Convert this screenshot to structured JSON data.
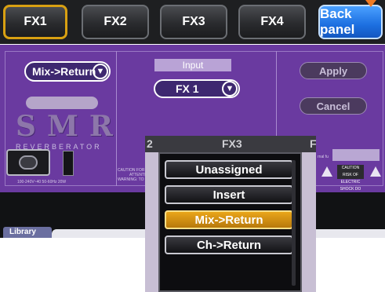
{
  "tabs": [
    {
      "label": "FX1",
      "active": true
    },
    {
      "label": "FX2",
      "active": false
    },
    {
      "label": "FX3",
      "active": false
    },
    {
      "label": "FX4",
      "active": false
    }
  ],
  "back_panel_label": "Back panel",
  "panel": {
    "routing_value": "Mix->Return",
    "input_label": "Input",
    "fx_value": "FX 1",
    "apply_label": "Apply",
    "cancel_label": "Cancel",
    "brand": "SMR",
    "subbrand": "REVERBERATOR",
    "power_spec": "100-240V~40 50-60Hz 20W",
    "caution_line1": "CAUTION FOR CONTINUED PROTECTION",
    "caution_line2": "ATTENTION",
    "caution_line3": "WARNING: TO REDUCE THE RISK",
    "caution_badge": "CAUTION",
    "caution_badge_sub": "RISK OF ELECTRIC SHOCK DO NOT OPEN",
    "terminal_text": "rnal fu"
  },
  "popup": {
    "header_left": "2",
    "header_center": "FX3",
    "header_right": "F",
    "options": [
      "Unassigned",
      "Insert",
      "Mix->Return",
      "Ch->Return"
    ],
    "selected": "Mix->Return"
  },
  "library_label": "Library",
  "colors": {
    "accent": "#d8a012",
    "panel": "#6a3aa0",
    "back_button": "#1c6fe0",
    "arrow": "#f07a22"
  }
}
